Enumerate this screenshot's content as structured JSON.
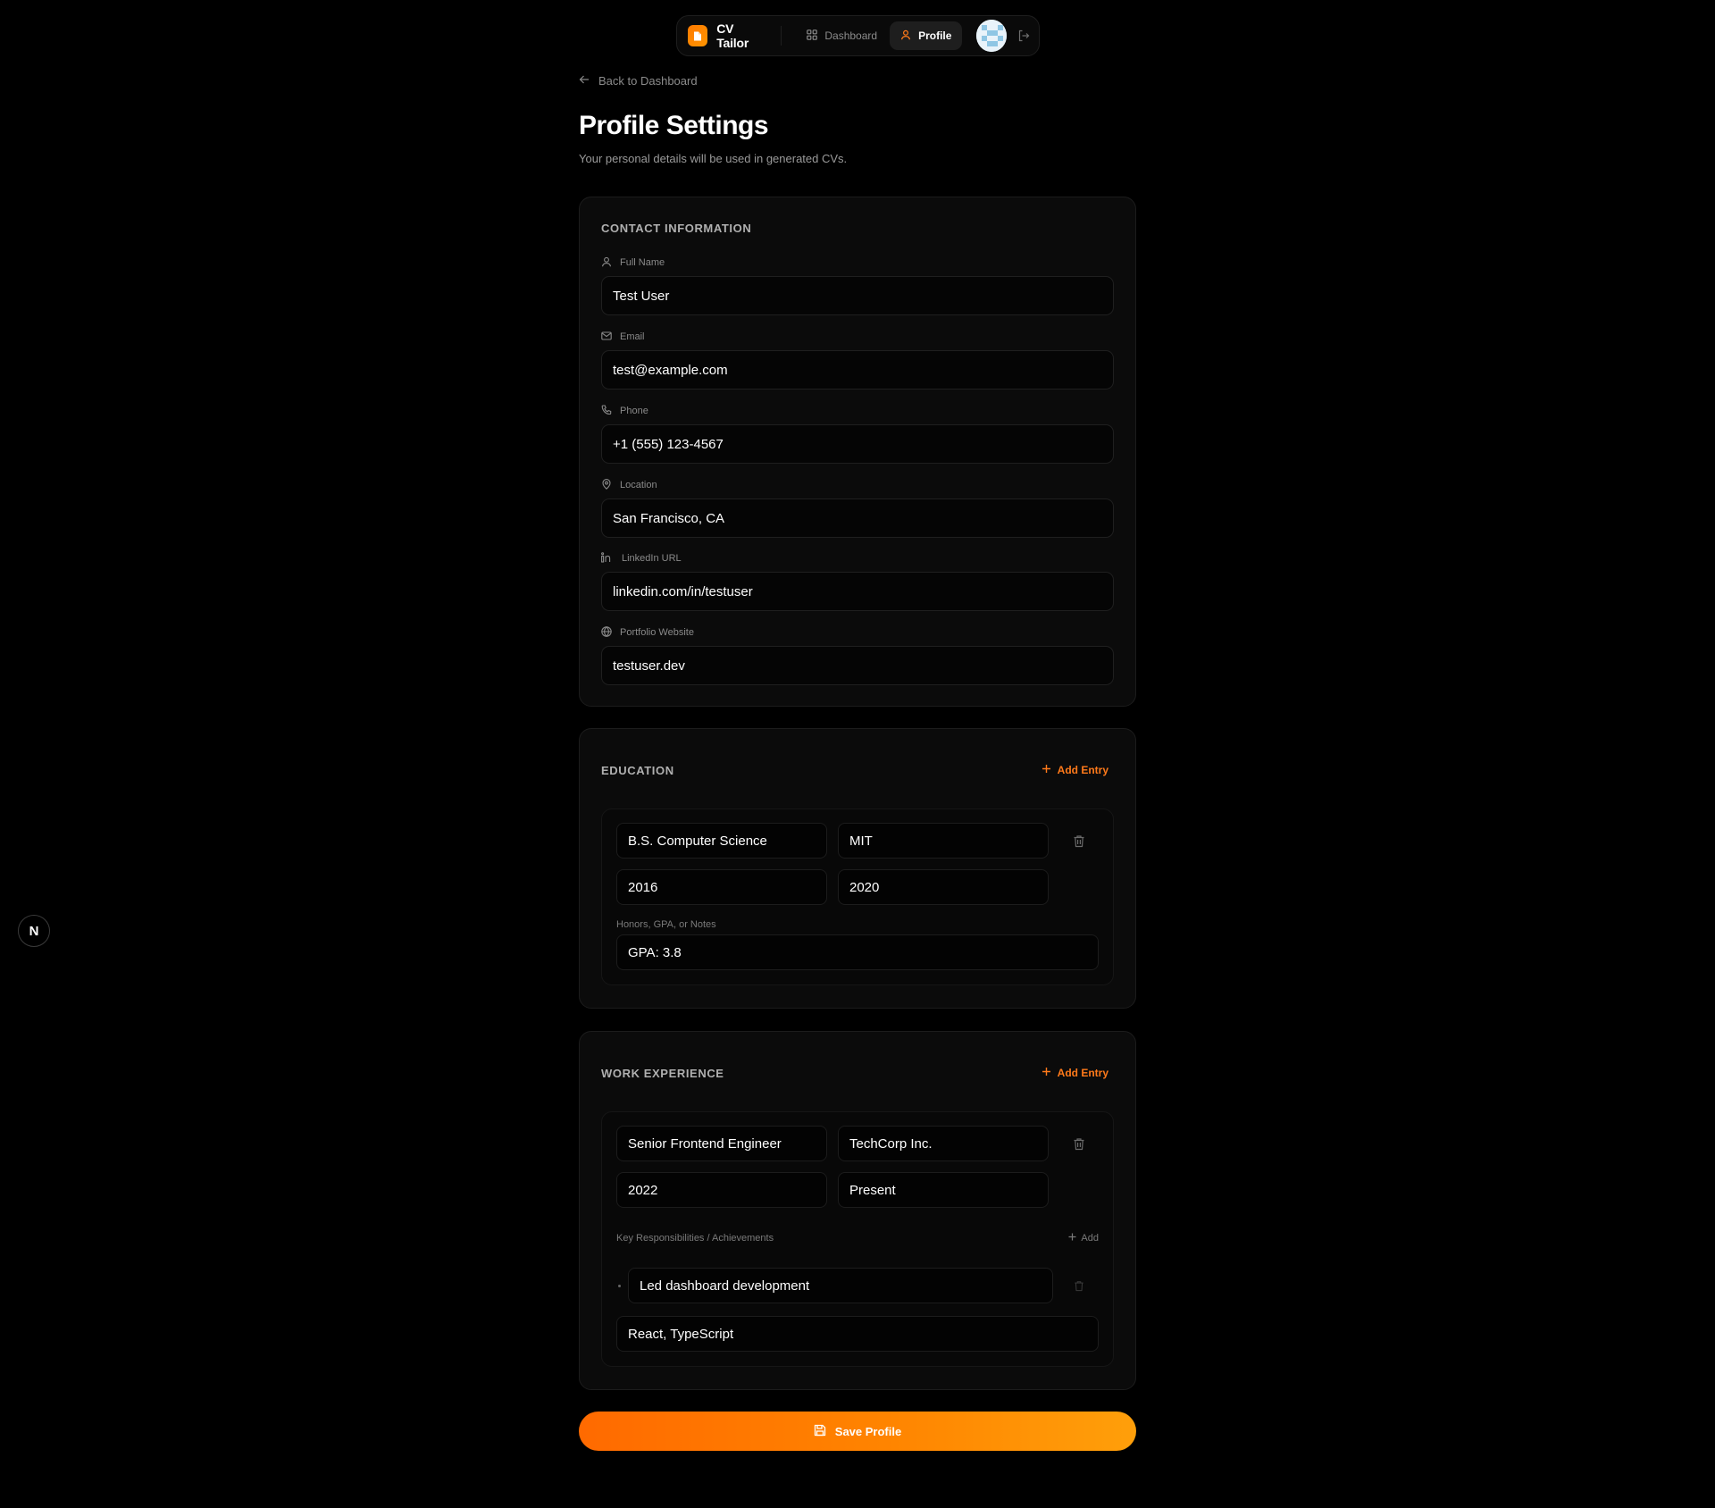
{
  "nav": {
    "brand": "CV Tailor",
    "dashboard": "Dashboard",
    "profile": "Profile"
  },
  "back_link": "Back to Dashboard",
  "page": {
    "title": "Profile Settings",
    "subtitle": "Your personal details will be used in generated CVs."
  },
  "contact": {
    "title": "CONTACT INFORMATION",
    "fields": [
      {
        "label": "Full Name",
        "value": "Test User",
        "icon": "user-icon"
      },
      {
        "label": "Email",
        "value": "test@example.com",
        "icon": "mail-icon"
      },
      {
        "label": "Phone",
        "value": "+1 (555) 123-4567",
        "icon": "phone-icon"
      },
      {
        "label": "Location",
        "value": "San Francisco, CA",
        "icon": "map-pin-icon"
      },
      {
        "label": "LinkedIn URL",
        "value": "linkedin.com/in/testuser",
        "icon": "linkedin-icon"
      },
      {
        "label": "Portfolio Website",
        "value": "testuser.dev",
        "icon": "globe-icon"
      }
    ]
  },
  "education": {
    "title": "EDUCATION",
    "add_label": "Add Entry",
    "entry": {
      "degree": "B.S. Computer Science",
      "school": "MIT",
      "start": "2016",
      "end": "2020",
      "notes_label": "Honors, GPA, or Notes",
      "notes": "GPA: 3.8"
    }
  },
  "work": {
    "title": "WORK EXPERIENCE",
    "add_label": "Add Entry",
    "entry": {
      "role": "Senior Frontend Engineer",
      "company": "TechCorp Inc.",
      "start": "2022",
      "end": "Present",
      "resp_label": "Key Responsibilities / Achievements",
      "resp_add": "Add",
      "bullets": [
        "Led dashboard development"
      ],
      "skills": "React, TypeScript"
    }
  },
  "save_label": "Save Profile",
  "floating_badge": "N",
  "colors": {
    "accent": "#ff7a1a",
    "background": "#000000",
    "card": "#0b0b0b"
  }
}
